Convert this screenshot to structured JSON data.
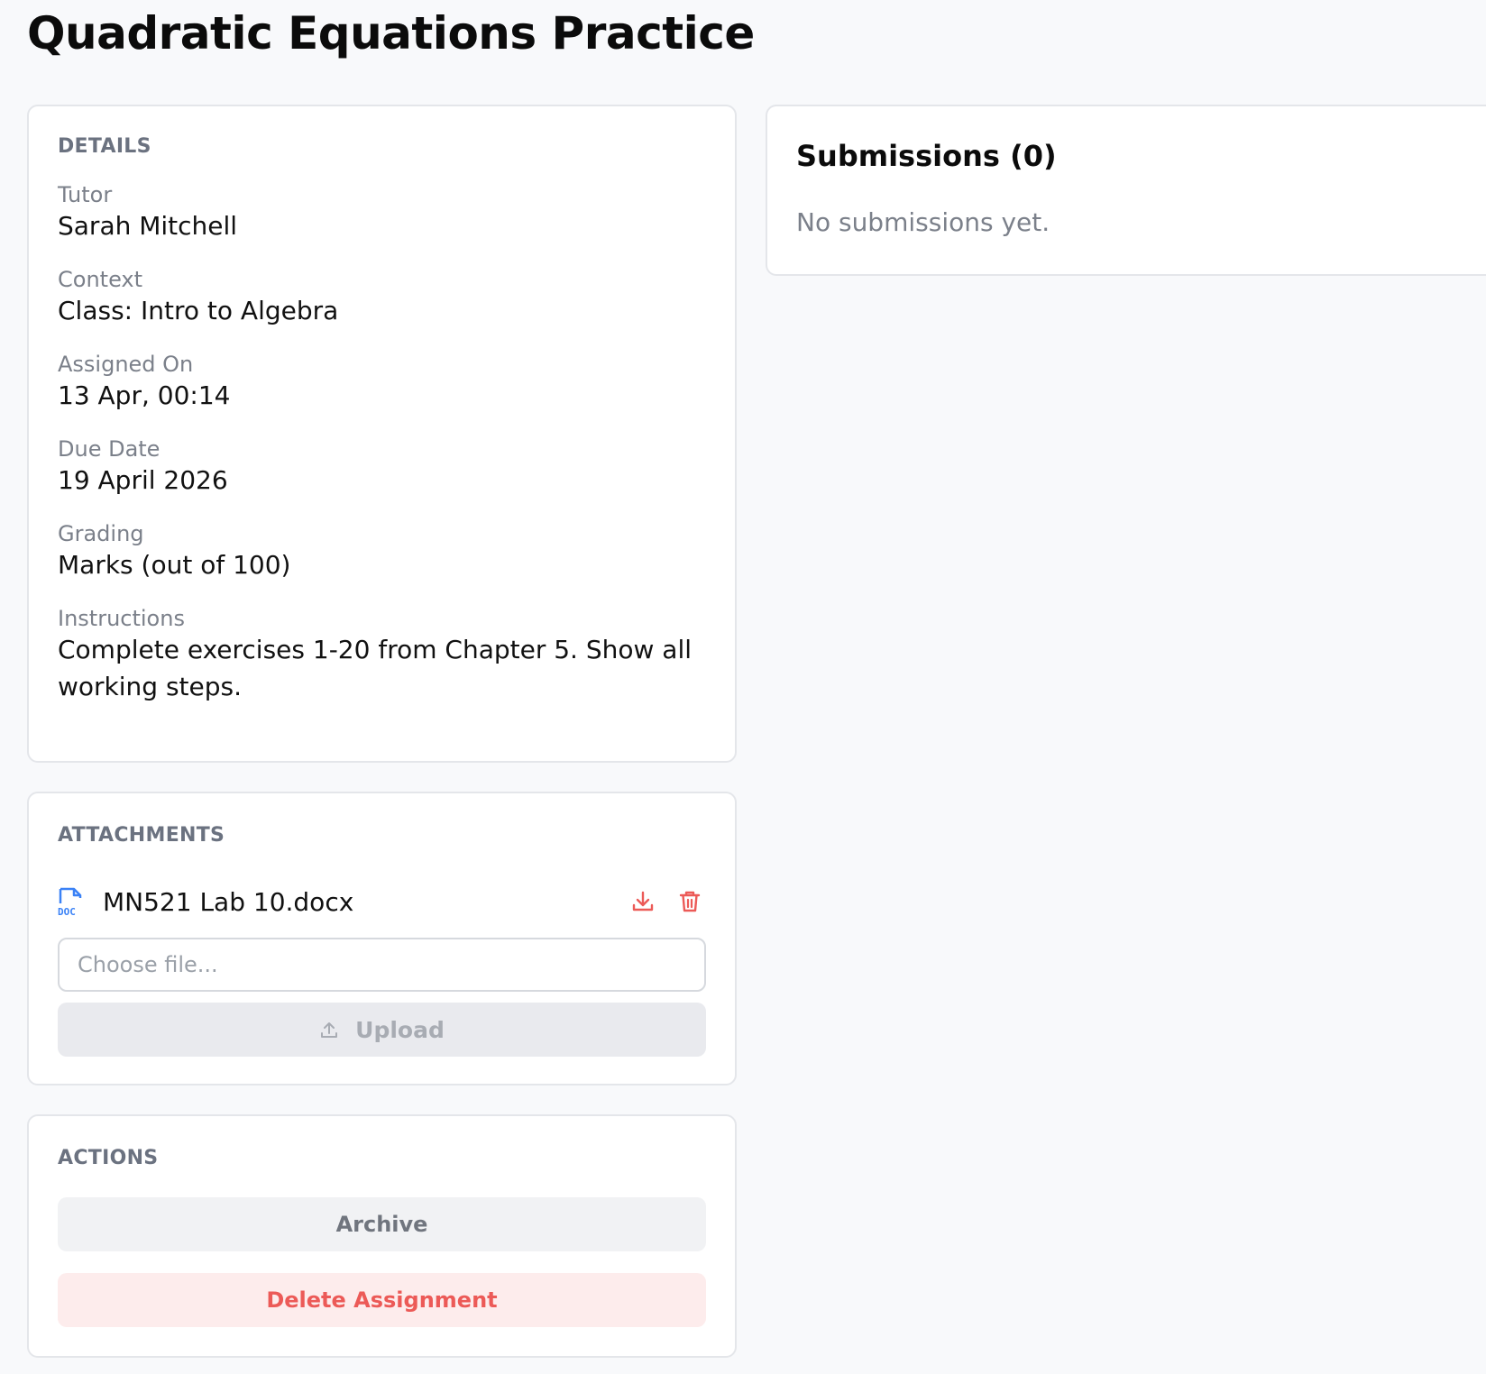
{
  "page": {
    "title": "Quadratic Equations Practice"
  },
  "details": {
    "heading": "DETAILS",
    "fields": [
      {
        "label": "Tutor",
        "value": "Sarah Mitchell"
      },
      {
        "label": "Context",
        "value": "Class: Intro to Algebra"
      },
      {
        "label": "Assigned On",
        "value": "13 Apr, 00:14"
      },
      {
        "label": "Due Date",
        "value": "19 April 2026"
      },
      {
        "label": "Grading",
        "value": "Marks (out of 100)"
      },
      {
        "label": "Instructions",
        "value": "Complete exercises 1-20 from Chapter 5. Show all working steps."
      }
    ]
  },
  "attachments": {
    "heading": "ATTACHMENTS",
    "files": [
      {
        "name": "MN521 Lab 10.docx",
        "icon": "doc-file-icon",
        "type_label": "DOC"
      }
    ],
    "file_input_placeholder": "Choose file...",
    "upload_label": "Upload"
  },
  "actions": {
    "heading": "ACTIONS",
    "archive_label": "Archive",
    "delete_label": "Delete Assignment"
  },
  "submissions": {
    "heading": "Submissions (0)",
    "empty_text": "No submissions yet."
  },
  "colors": {
    "accent_danger": "#ec5a57",
    "doc_icon": "#3b82f6",
    "muted_text": "#7b808a"
  }
}
